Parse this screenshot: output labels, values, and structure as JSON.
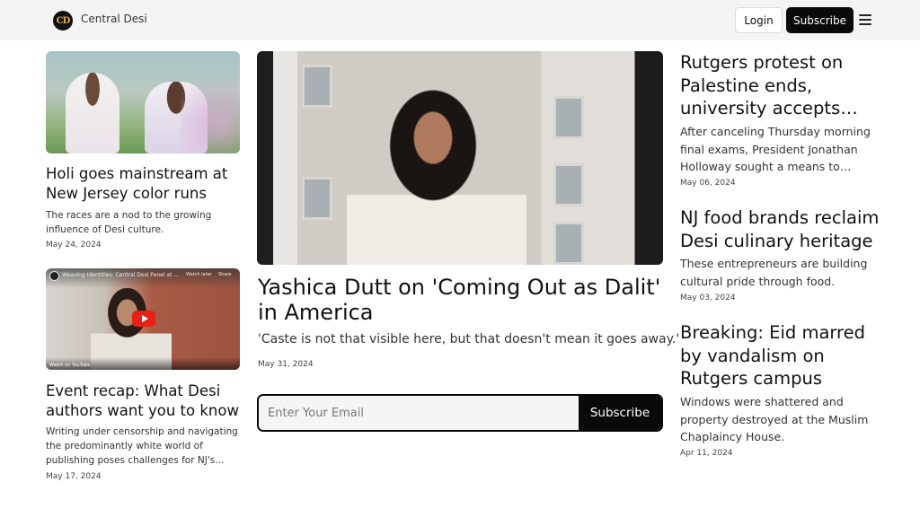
{
  "header": {
    "logo_text": "CD",
    "site_name": "Central Desi",
    "login_label": "Login",
    "subscribe_label": "Subscribe",
    "menu_icon": "hamburger-menu-icon"
  },
  "left_cards": [
    {
      "title": "Holi goes mainstream at New Jersey color runs",
      "description": "The races are a nod to the growing influence of Desi culture.",
      "date": "May 24, 2024"
    },
    {
      "video_title": "Weaving Identities: Central Desi Panel at ...",
      "video_watch_later": "Watch later",
      "video_share": "Share",
      "video_watch_on": "Watch on YouTube",
      "title": "Event recap: What Desi authors want you to know",
      "description": "Writing under censorship and navigating the predominantly white world of publishing poses challenges for NJ's Desi…",
      "date": "May 17, 2024"
    }
  ],
  "hero": {
    "title": "Yashica Dutt on 'Coming Out as Dalit' in America",
    "quote": "'Caste is not that visible here, but that doesn't mean it goes away.'",
    "date": "May 31, 2024"
  },
  "newsletter": {
    "placeholder": "Enter Your Email",
    "button_label": "Subscribe"
  },
  "right_cards": [
    {
      "title": "Rutgers protest on Palestine ends, university accepts…",
      "description": "After canceling Thursday morning final exams, President Jonathan Holloway sought a means to \"de-…",
      "date": "May 06, 2024"
    },
    {
      "title": "NJ food brands reclaim Desi culinary heritage",
      "description": "These entrepreneurs are building cultural pride through food.",
      "date": "May 03, 2024"
    },
    {
      "title": "Breaking: Eid marred by vandalism on Rutgers campus",
      "description": "Windows were shattered and property destroyed at the Muslim Chaplaincy House.",
      "date": "Apr 11, 2024"
    }
  ]
}
